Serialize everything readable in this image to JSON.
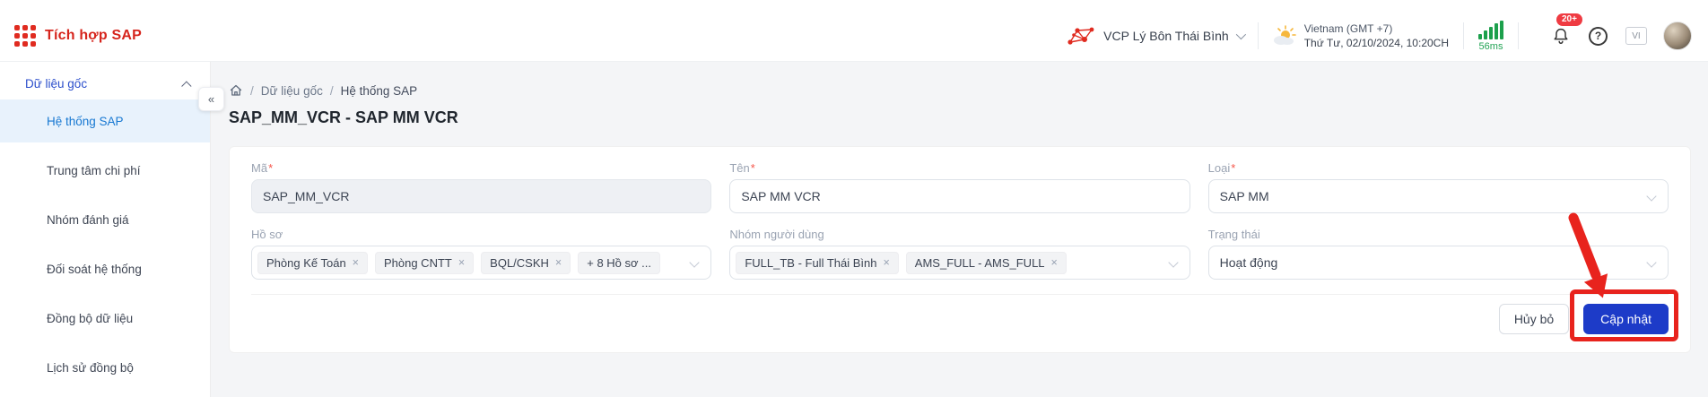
{
  "header": {
    "app_title": "Tích hợp SAP",
    "org_name": "VCP Lý Bôn Thái Bình",
    "region": "Vietnam (GMT +7)",
    "datetime": "Thứ Tư, 02/10/2024, 10:20CH",
    "latency": "56ms",
    "notification_count": "20+",
    "language": "VI"
  },
  "sidebar": {
    "group_label": "Dữ liệu gốc",
    "items": [
      {
        "label": "Hệ thống SAP",
        "active": true
      },
      {
        "label": "Trung tâm chi phí"
      },
      {
        "label": "Nhóm đánh giá"
      },
      {
        "label": "Đối soát hệ thống"
      },
      {
        "label": "Đồng bộ dữ liệu"
      },
      {
        "label": "Lịch sử đồng bộ"
      }
    ]
  },
  "breadcrumb": {
    "separator": "/",
    "items": [
      "Dữ liệu gốc",
      "Hệ thống SAP"
    ]
  },
  "page": {
    "title": "SAP_MM_VCR - SAP MM VCR"
  },
  "form": {
    "required_marker": "*",
    "fields": {
      "ma": {
        "label": "Mã",
        "value": "SAP_MM_VCR",
        "disabled": true
      },
      "ten": {
        "label": "Tên",
        "value": "SAP MM VCR"
      },
      "loai": {
        "label": "Loại",
        "value": "SAP MM"
      },
      "ho_so": {
        "label": "Hồ sơ",
        "tags": [
          "Phòng Kế Toán",
          "Phòng CNTT",
          "BQL/CSKH",
          "+ 8 Hồ sơ ..."
        ]
      },
      "nhom_nguoi_dung": {
        "label": "Nhóm người dùng",
        "tags": [
          "FULL_TB - Full Thái Bình",
          "AMS_FULL - AMS_FULL"
        ]
      },
      "trang_thai": {
        "label": "Trạng thái",
        "value": "Hoạt động"
      }
    },
    "buttons": {
      "cancel": "Hủy bỏ",
      "submit": "Cập nhật"
    }
  },
  "icons": {
    "collapse": "«",
    "close": "×",
    "help": "?"
  },
  "colors": {
    "brand_red": "#d6251d",
    "primary_blue": "#1d3bc8",
    "annotation_red": "#e8231d",
    "latency_green": "#1ca04c",
    "sidebar_active_bg": "#e8f2fc",
    "sidebar_active_text": "#1778d2"
  }
}
